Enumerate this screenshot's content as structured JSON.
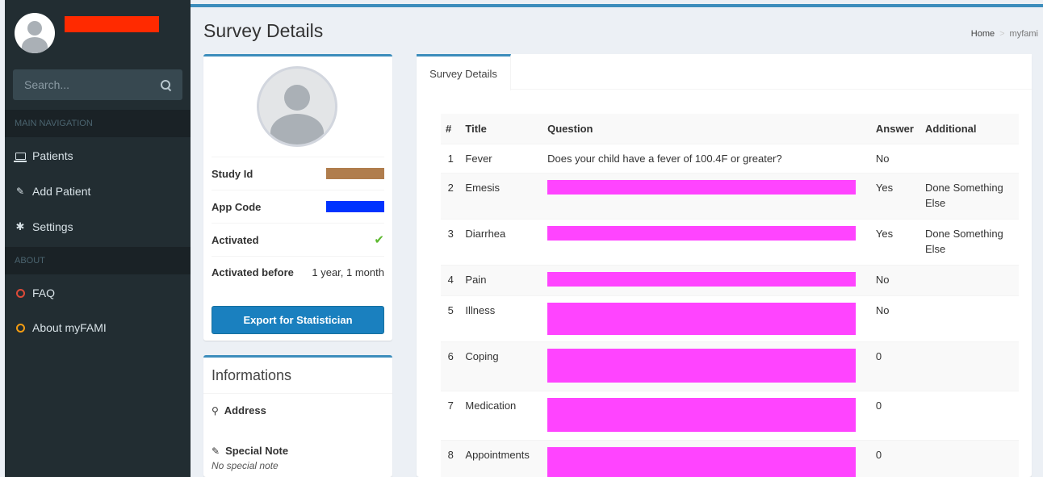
{
  "sidebar": {
    "search_placeholder": "Search...",
    "nav_header_main": "MAIN NAVIGATION",
    "nav_header_about": "ABOUT",
    "items": [
      {
        "label": "Patients",
        "icon": "laptop-icon"
      },
      {
        "label": "Add Patient",
        "icon": "edit-icon"
      },
      {
        "label": "Settings",
        "icon": "gear-icon"
      }
    ],
    "about_items": [
      {
        "label": "FAQ",
        "icon": "circle-icon",
        "color": "#dd4b39"
      },
      {
        "label": "About myFAMI",
        "icon": "circle-icon",
        "color": "#f39c12"
      }
    ]
  },
  "header": {
    "title": "Survey Details",
    "breadcrumb": [
      "Home",
      "myfami"
    ]
  },
  "profile": {
    "rows": [
      {
        "label": "Study Id",
        "value": ""
      },
      {
        "label": "App Code",
        "value": ""
      },
      {
        "label": "Activated",
        "value": "✔"
      },
      {
        "label": "Activated before",
        "value": "1 year, 1 month"
      }
    ],
    "export_button": "Export for Statistician"
  },
  "informations": {
    "title": "Informations",
    "address_label": "Address",
    "special_note_label": "Special Note",
    "special_note_value": "No special note"
  },
  "survey": {
    "tab": "Survey Details",
    "columns": [
      "#",
      "Title",
      "Question",
      "Answer",
      "Additional"
    ],
    "rows": [
      {
        "num": "1",
        "title": "Fever",
        "question": "Does your child have a fever of 100.4F or greater?",
        "answer": "No",
        "additional": ""
      },
      {
        "num": "2",
        "title": "Emesis",
        "question": "",
        "answer": "Yes",
        "additional": "Done Something Else"
      },
      {
        "num": "3",
        "title": "Diarrhea",
        "question": "",
        "answer": "Yes",
        "additional": "Done Something Else"
      },
      {
        "num": "4",
        "title": "Pain",
        "question": "",
        "answer": "No",
        "additional": ""
      },
      {
        "num": "5",
        "title": "Illness",
        "question": "",
        "answer": "No",
        "additional": ""
      },
      {
        "num": "6",
        "title": "Coping",
        "question": "",
        "answer": "0",
        "additional": ""
      },
      {
        "num": "7",
        "title": "Medication",
        "question": "",
        "answer": "0",
        "additional": ""
      },
      {
        "num": "8",
        "title": "Appointments",
        "question": "",
        "answer": "0",
        "additional": ""
      }
    ]
  },
  "colors": {
    "accent": "#3c8dbc",
    "sidebar_bg": "#222d32",
    "redaction_pink": "#ff44ff",
    "redaction_red": "#ff2a00",
    "redaction_brown": "#b07d4d",
    "redaction_blue": "#0033ff"
  }
}
